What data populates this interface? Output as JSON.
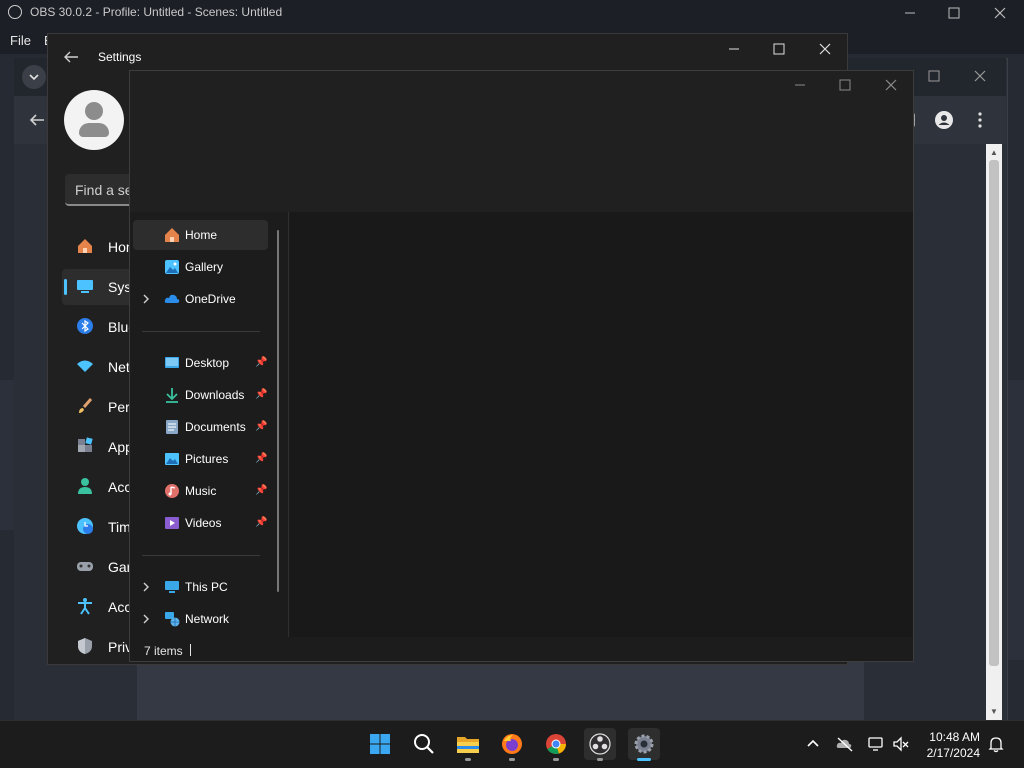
{
  "obs": {
    "title": "OBS 30.0.2 - Profile: Untitled - Scenes: Untitled",
    "menu": [
      "File",
      "E"
    ]
  },
  "settings": {
    "title": "Settings",
    "search_placeholder": "Find a se",
    "nav": [
      {
        "label": "Hom",
        "icon": "home-icon",
        "active": false
      },
      {
        "label": "Syst",
        "icon": "system-icon",
        "active": true
      },
      {
        "label": "Blue",
        "icon": "bluetooth-icon",
        "active": false
      },
      {
        "label": "Net",
        "icon": "network-wifi-icon",
        "active": false
      },
      {
        "label": "Pers",
        "icon": "personalization-brush-icon",
        "active": false
      },
      {
        "label": "App",
        "icon": "apps-icon",
        "active": false
      },
      {
        "label": "Acc",
        "icon": "accounts-icon",
        "active": false
      },
      {
        "label": "Tim",
        "icon": "time-language-icon",
        "active": false
      },
      {
        "label": "Gar",
        "icon": "gaming-controller-icon",
        "active": false
      },
      {
        "label": "Acc",
        "icon": "accessibility-icon",
        "active": false
      },
      {
        "label": "Priv",
        "icon": "privacy-shield-icon",
        "active": false
      }
    ]
  },
  "explorer": {
    "nav": {
      "home": "Home",
      "gallery": "Gallery",
      "onedrive": "OneDrive",
      "desktop": "Desktop",
      "downloads": "Downloads",
      "documents": "Documents",
      "pictures": "Pictures",
      "music": "Music",
      "videos": "Videos",
      "this_pc": "This PC",
      "network": "Network"
    },
    "status": "7 items"
  },
  "taskbar": {
    "apps": [
      "start-icon",
      "search-icon",
      "file-explorer-icon",
      "firefox-icon",
      "chrome-icon",
      "obs-icon",
      "settings-gear-icon"
    ],
    "time": "10:48 AM",
    "date": "2/17/2024"
  },
  "colors": {
    "accent": "#4cc2ff",
    "folder": "#f2c14e"
  }
}
